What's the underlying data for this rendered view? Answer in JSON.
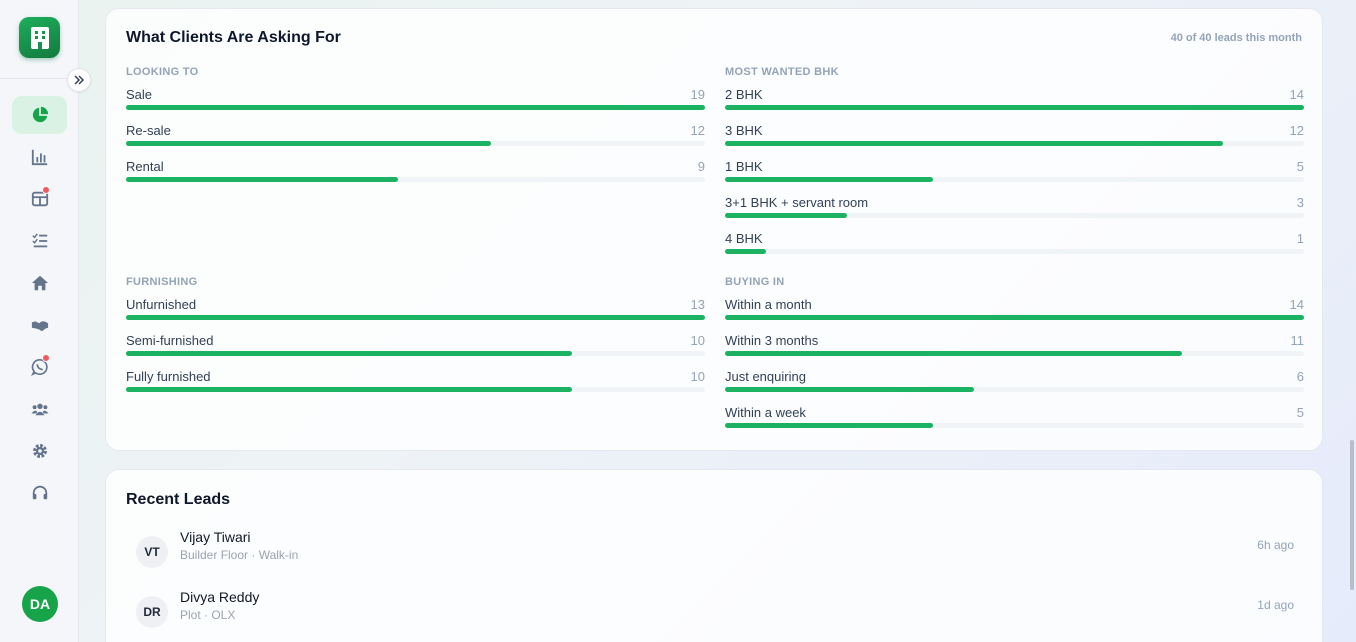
{
  "sidebar": {
    "user_initials": "DA",
    "items": [
      {
        "name": "dashboard",
        "icon": "pie-chart-icon",
        "active": true
      },
      {
        "name": "analytics",
        "icon": "bar-chart-icon"
      },
      {
        "name": "board",
        "icon": "board-icon",
        "badge": true
      },
      {
        "name": "tasks",
        "icon": "checklist-icon"
      },
      {
        "name": "properties",
        "icon": "home-icon"
      },
      {
        "name": "deals",
        "icon": "handshake-icon"
      },
      {
        "name": "whatsapp",
        "icon": "whatsapp-icon",
        "badge": true
      },
      {
        "name": "team",
        "icon": "users-icon"
      },
      {
        "name": "settings",
        "icon": "gear-icon"
      },
      {
        "name": "support",
        "icon": "headset-icon"
      }
    ]
  },
  "asking": {
    "title": "What Clients Are Asking For",
    "meta": "40 of 40 leads this month",
    "sections": [
      {
        "label": "LOOKING TO",
        "rows": [
          {
            "label": "Sale",
            "value": 19,
            "fraction": 1.0
          },
          {
            "label": "Re-sale",
            "value": 12,
            "fraction": 0.63
          },
          {
            "label": "Rental",
            "value": 9,
            "fraction": 0.47
          }
        ]
      },
      {
        "label": "MOST WANTED BHK",
        "rows": [
          {
            "label": "2 BHK",
            "value": 14,
            "fraction": 1.0
          },
          {
            "label": "3 BHK",
            "value": 12,
            "fraction": 0.86
          },
          {
            "label": "1 BHK",
            "value": 5,
            "fraction": 0.36
          },
          {
            "label": "3+1 BHK + servant room",
            "value": 3,
            "fraction": 0.21
          },
          {
            "label": "4 BHK",
            "value": 1,
            "fraction": 0.07
          }
        ]
      },
      {
        "label": "FURNISHING",
        "rows": [
          {
            "label": "Unfurnished",
            "value": 13,
            "fraction": 1.0
          },
          {
            "label": "Semi-furnished",
            "value": 10,
            "fraction": 0.77
          },
          {
            "label": "Fully furnished",
            "value": 10,
            "fraction": 0.77
          }
        ]
      },
      {
        "label": "BUYING IN",
        "rows": [
          {
            "label": "Within a month",
            "value": 14,
            "fraction": 1.0
          },
          {
            "label": "Within 3 months",
            "value": 11,
            "fraction": 0.79
          },
          {
            "label": "Just enquiring",
            "value": 6,
            "fraction": 0.43
          },
          {
            "label": "Within a week",
            "value": 5,
            "fraction": 0.36
          }
        ]
      }
    ]
  },
  "leads": {
    "title": "Recent Leads",
    "rows": [
      {
        "initials": "VT",
        "name": "Vijay Tiwari",
        "sub": "Builder Floor · Walk-in",
        "time": "6h ago"
      },
      {
        "initials": "DR",
        "name": "Divya Reddy",
        "sub": "Plot · OLX",
        "time": "1d ago"
      }
    ]
  }
}
